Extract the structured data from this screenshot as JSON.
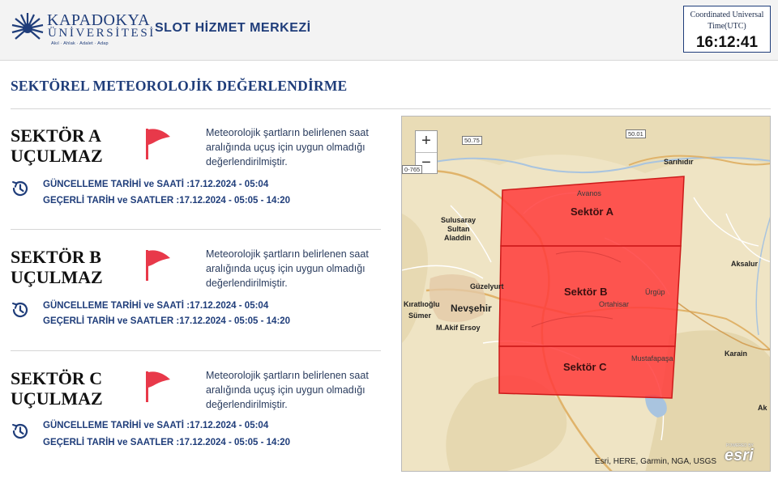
{
  "header": {
    "logo_name": "KAPADOKYA",
    "logo_sub": "ÜNİVERSİTESİ",
    "logo_motto": "Akıl · Ahlak · Adalet · Adap",
    "app_title": "SLOT HİZMET MERKEZİ",
    "utc_label": "Coordinated Universal Time(UTC)",
    "utc_time": "16:12:41"
  },
  "page_title": "SEKTÖREL METEOROLOJİK DEĞERLENDİRME",
  "sectors": [
    {
      "name": "SEKTÖR A",
      "status": "UÇULMAZ",
      "description": "Meteorolojik şartların belirlenen saat aralığında uçuş için uygun olmadığı değerlendirilmiştir.",
      "update_line": "GÜNCELLEME TARİHİ ve SAATİ :17.12.2024 - 05:04",
      "valid_line": "GEÇERLİ TARİH ve SAATLER :17.12.2024 - 05:05 - 14:20"
    },
    {
      "name": "SEKTÖR B",
      "status": "UÇULMAZ",
      "description": "Meteorolojik şartların belirlenen saat aralığında uçuş için uygun olmadığı değerlendirilmiştir.",
      "update_line": "GÜNCELLEME TARİHİ ve SAATİ :17.12.2024 - 05:04",
      "valid_line": "GEÇERLİ TARİH ve SAATLER :17.12.2024 - 05:05 - 14:20"
    },
    {
      "name": "SEKTÖR C",
      "status": "UÇULMAZ",
      "description": "Meteorolojik şartların belirlenen saat aralığında uçuş için uygun olmadığı değerlendirilmiştir.",
      "update_line": "GÜNCELLEME TARİHİ ve SAATİ :17.12.2024 - 05:04",
      "valid_line": "GEÇERLİ TARİH ve SAATLER :17.12.2024 - 05:05 - 14:20"
    }
  ],
  "map": {
    "zoom_in": "+",
    "zoom_out": "−",
    "places": {
      "sarihidir": "Sarıhıdır",
      "avanos": "Avanos",
      "sulusaray": "Sulusaray",
      "sultan": "Sultan",
      "aladdin": "Aladdin",
      "guzelyurt": "Güzelyurt",
      "kiratlioglu": "Kıratlıoğlu",
      "sumer": "Sümer",
      "nevsehir": "Nevşehir",
      "makif": "M.Akif Ersoy",
      "urgup": "Ürgüp",
      "ortahisar": "Ortahisar",
      "aksalur": "Aksalur",
      "karain": "Karain",
      "mustafapasa": "Mustafapaşa",
      "ak": "Ak"
    },
    "roads": {
      "r1": "50.75",
      "r2": "50.01",
      "r3": "0-765"
    },
    "sector_labels": {
      "a": "Sektör A",
      "b": "Sektör B",
      "c": "Sektör C"
    },
    "attribution": "Esri, HERE, Garmin, NGA, USGS",
    "esri_brand": "esri",
    "powered_by": "POWERED BY",
    "sector_color": "#ff3b3b"
  },
  "colors": {
    "brand": "#1f3d7a",
    "flag": "#e8394a",
    "sector_fill": "#ff3b3b"
  }
}
